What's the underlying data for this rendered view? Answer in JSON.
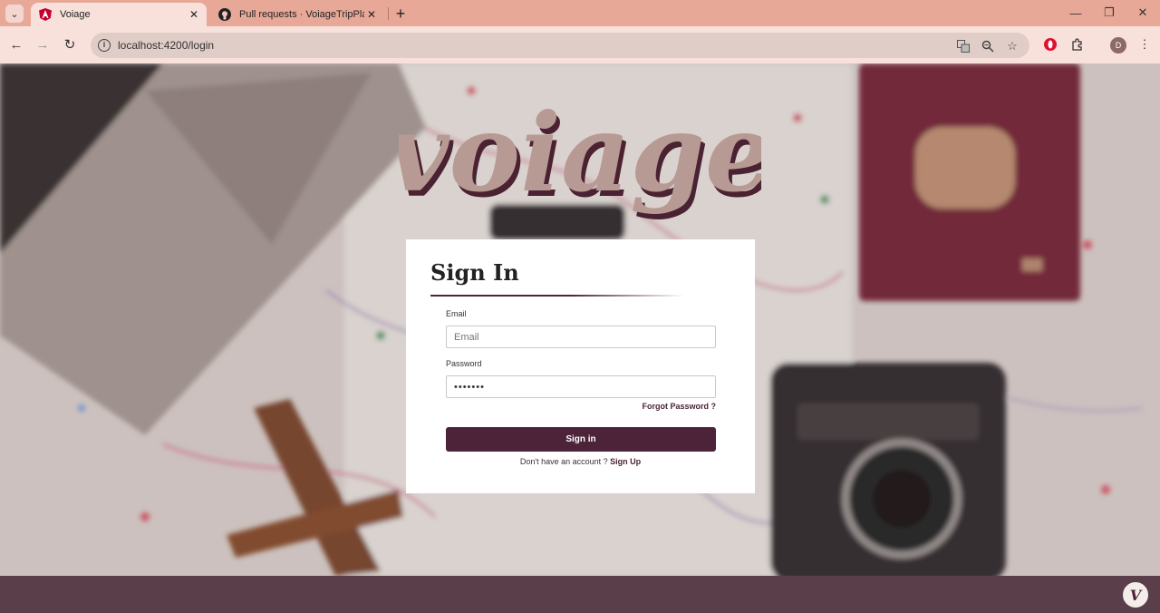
{
  "browser": {
    "tabs": [
      {
        "title": "Voiage",
        "favicon": "angular-icon"
      },
      {
        "title": "Pull requests · VoiageTripPlanner",
        "favicon": "github-icon"
      }
    ],
    "url": "localhost:4200/login",
    "profile_initial": "D",
    "colors": {
      "tabstrip": "#e8a898",
      "toolbar": "#f8e1db"
    }
  },
  "page": {
    "logo_text": "voiage",
    "signin": {
      "heading": "Sign In",
      "email_label": "Email",
      "email_placeholder": "Email",
      "password_label": "Password",
      "password_value": "•••••••",
      "forgot_link": "Forgot Password ?",
      "submit_label": "Sign in",
      "signup_prompt": "Don't have an account ?",
      "signup_link": "Sign Up"
    },
    "corner_badge": "V",
    "colors": {
      "accent": "#4c2338",
      "footer": "#5a3e4a",
      "logo": "#b89a94"
    }
  }
}
